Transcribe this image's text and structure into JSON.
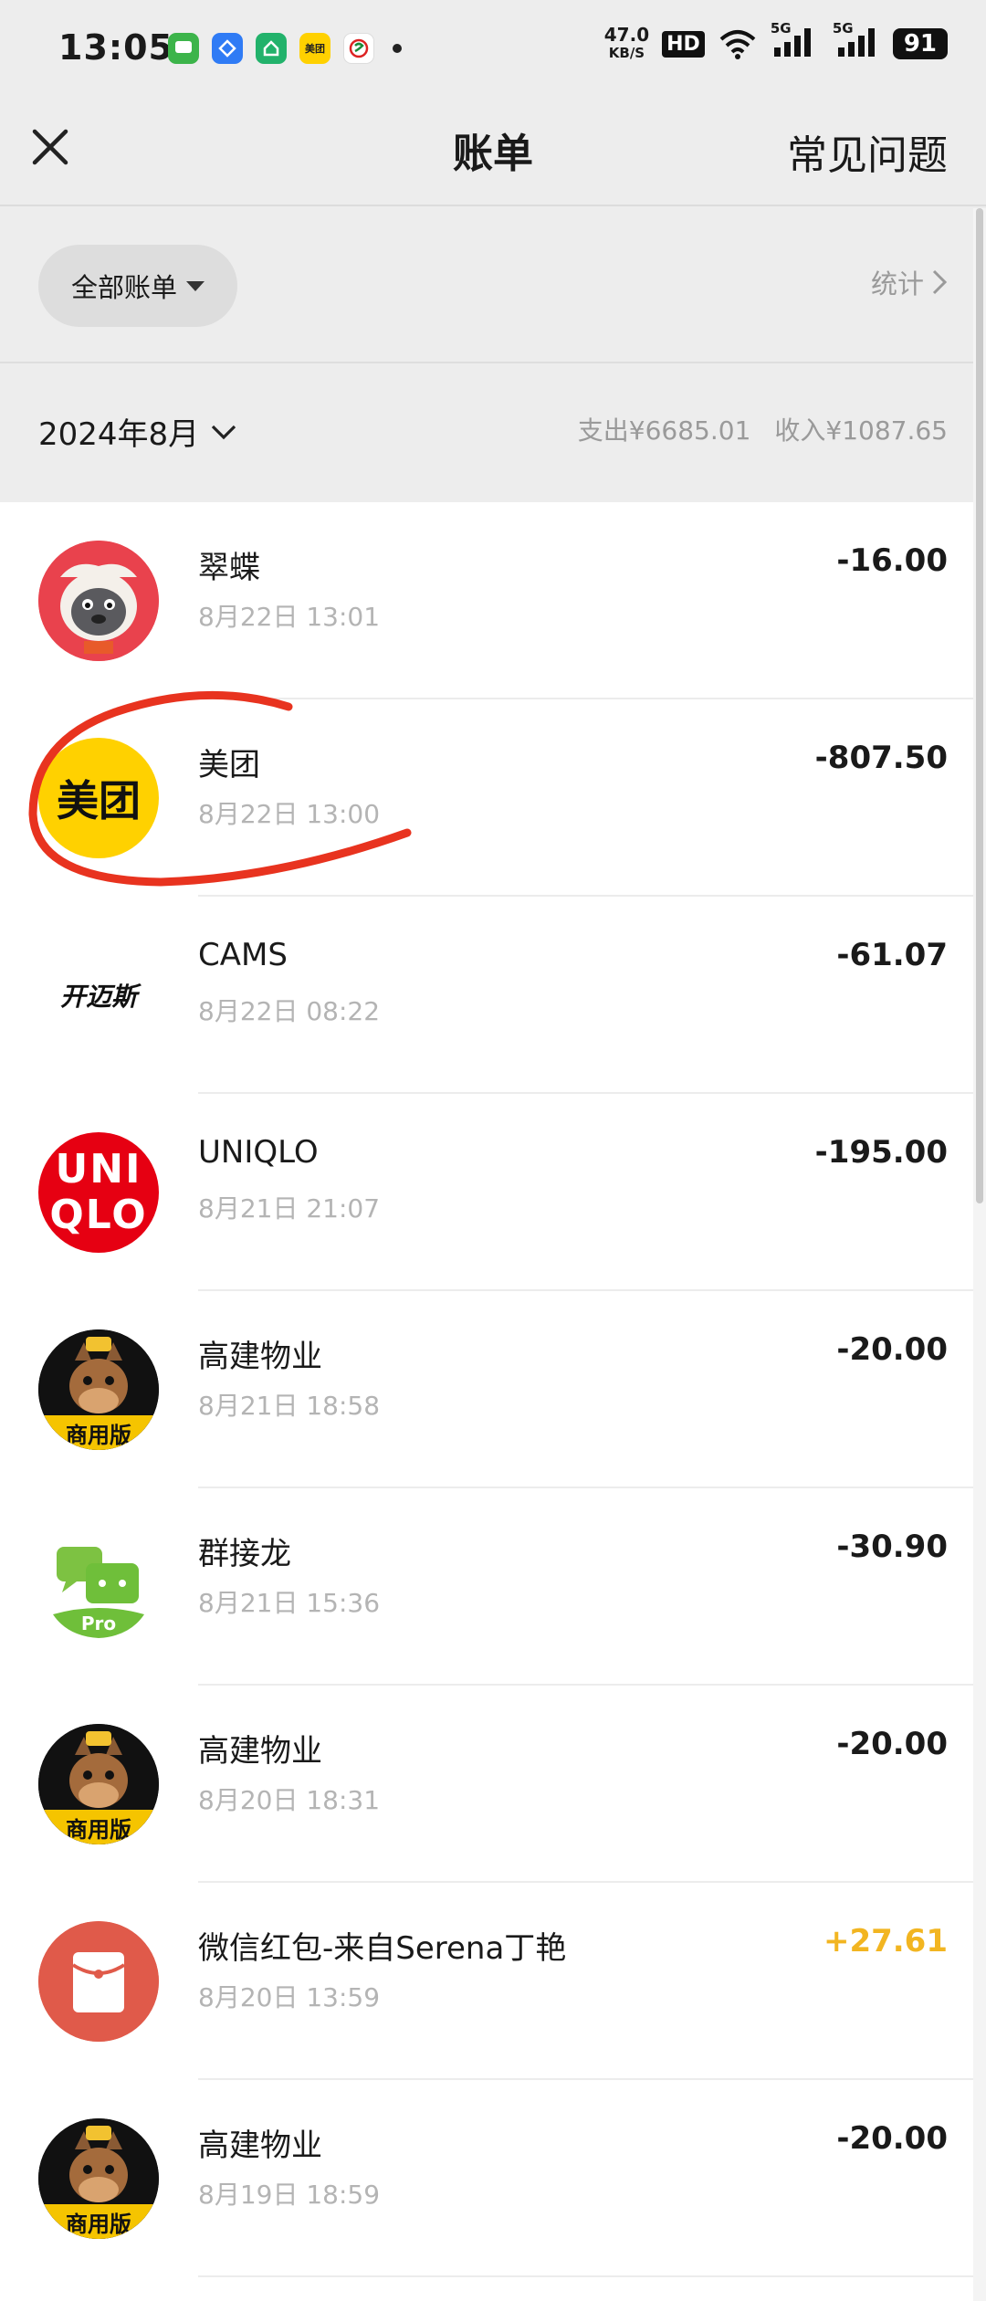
{
  "status_bar": {
    "time": "13:05",
    "net_speed": "47.0",
    "net_speed_unit": "KB/S",
    "hd": "HD",
    "signal1": "5G",
    "signal2": "5G",
    "battery": "91",
    "app_icons": [
      "messages-icon",
      "gallery-icon",
      "home-icon",
      "meituan-icon",
      "subway-icon"
    ]
  },
  "nav": {
    "title": "账单",
    "right_link": "常见问题"
  },
  "filter": {
    "all_bills": "全部账单",
    "stats": "统计"
  },
  "month": {
    "label": "2024年8月",
    "expense": "支出¥6685.01",
    "income": "收入¥1087.65"
  },
  "transactions": [
    {
      "name": "翠蝶",
      "time": "8月22日 13:01",
      "amount": "-16.00",
      "type": "expense",
      "avatar": "cartoon-animal-avatar"
    },
    {
      "name": "美团",
      "time": "8月22日 13:00",
      "amount": "-807.50",
      "type": "expense",
      "avatar": "meituan-logo"
    },
    {
      "name": "CAMS",
      "time": "8月22日 08:22",
      "amount": "-61.07",
      "type": "expense",
      "avatar": "cams-logo"
    },
    {
      "name": "UNIQLO",
      "time": "8月21日 21:07",
      "amount": "-195.00",
      "type": "expense",
      "avatar": "uniqlo-logo"
    },
    {
      "name": "高建物业",
      "time": "8月21日 18:58",
      "amount": "-20.00",
      "type": "expense",
      "avatar": "commercial-horse-avatar"
    },
    {
      "name": "群接龙",
      "time": "8月21日 15:36",
      "amount": "-30.90",
      "type": "expense",
      "avatar": "qunjielong-logo"
    },
    {
      "name": "高建物业",
      "time": "8月20日 18:31",
      "amount": "-20.00",
      "type": "expense",
      "avatar": "commercial-horse-avatar"
    },
    {
      "name": "微信红包-来自Serena丁艳",
      "time": "8月20日 13:59",
      "amount": "+27.61",
      "type": "income",
      "avatar": "red-packet-icon"
    },
    {
      "name": "高建物业",
      "time": "8月19日 18:59",
      "amount": "-20.00",
      "type": "expense",
      "avatar": "commercial-horse-avatar"
    }
  ],
  "logo_text": {
    "meituan": "美团",
    "cams": "开迈斯",
    "uniqlo_top": "UNI",
    "uniqlo_bottom": "QLO",
    "commercial": "商用版",
    "pro": "Pro"
  },
  "colors": {
    "background": "#ededed",
    "list_bg": "#ffffff",
    "income": "#f2b521",
    "annotation": "#e8331f",
    "meituan_yellow": "#ffd100",
    "uniqlo_red": "#e60012",
    "red_packet": "#e05a4a"
  }
}
